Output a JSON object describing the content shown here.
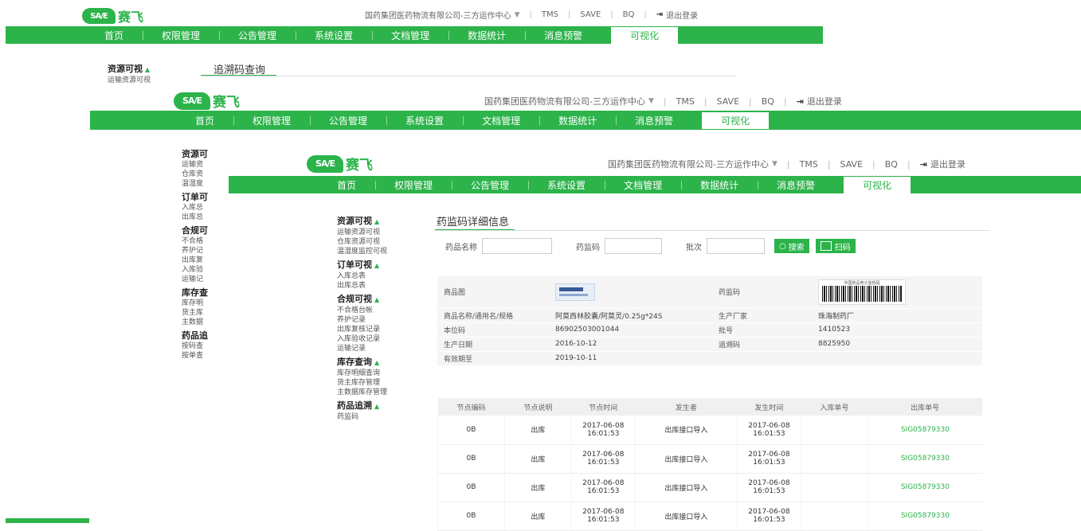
{
  "brand": {
    "badge": "SA/E",
    "name": "赛飞"
  },
  "topbar": {
    "company": "国药集团医药物流有限公司-三方运作中心",
    "links": [
      "TMS",
      "SAVE",
      "BQ"
    ],
    "logout": "退出登录"
  },
  "nav": {
    "items": [
      "首页",
      "权限管理",
      "公告管理",
      "系统设置",
      "文档管理",
      "数据统计",
      "消息预警",
      "可视化"
    ],
    "active": "可视化"
  },
  "sidebar": {
    "groups": [
      {
        "title": "资源可视",
        "items": [
          "运输资源可视",
          "仓库资源可视",
          "温湿度监控可视"
        ]
      },
      {
        "title": "订单可视",
        "items": [
          "入库总表",
          "出库总表"
        ]
      },
      {
        "title": "合规可视",
        "items": [
          "不合格台帐",
          "养护记录",
          "出库复核记录",
          "入库验收记录",
          "运输记录"
        ]
      },
      {
        "title": "库存查询",
        "items": [
          "库存明细查询",
          "货主库存管理",
          "主数据库存管理"
        ]
      },
      {
        "title": "药品追溯",
        "items": [
          "药监码"
        ]
      }
    ],
    "back2_groups": [
      "资源可",
      "订单可",
      "合规可",
      "库存查",
      "药品追"
    ],
    "back2_items": [
      "运输资",
      "仓库资",
      "温湿度",
      "入库总",
      "出库总",
      "不合格",
      "养护记",
      "出库复",
      "入库验",
      "运输记",
      "库存明",
      "货主库",
      "主数据",
      "按码查",
      "按单查"
    ]
  },
  "back_page": {
    "title": "追溯码查询"
  },
  "main": {
    "title": "药监码详细信息",
    "filters": {
      "drug_name_label": "药品名称",
      "code_label": "药监码",
      "batch_label": "批次",
      "search": "搜索",
      "scan": "扫码"
    },
    "detail": {
      "rows": [
        [
          "商品图",
          "",
          "药监码",
          ""
        ],
        [
          "商品名称/通用名/规格",
          "阿莫西林胶囊/阿莫灵/0.25g*24S",
          "生产厂家",
          "珠海制药厂"
        ],
        [
          "本位码",
          "86902503001044",
          "批号",
          "1410523"
        ],
        [
          "生产日期",
          "2016-10-12",
          "追溯码",
          "8825950"
        ],
        [
          "有效期至",
          "2019-10-11",
          "",
          ""
        ]
      ],
      "barcode_caption": "中国药品电子监管码"
    },
    "nodes": {
      "headers": [
        "节点编码",
        "节点说明",
        "节点时间",
        "发生者",
        "发生时间",
        "入库单号",
        "出库单号"
      ],
      "rows": [
        [
          "0B",
          "出库",
          "2017-06-08 16:01:53",
          "出库接口导入",
          "2017-06-08 16:01:53",
          "",
          "SIG05879330"
        ],
        [
          "0B",
          "出库",
          "2017-06-08 16:01:53",
          "出库接口导入",
          "2017-06-08 16:01:53",
          "",
          "SIG05879330"
        ],
        [
          "0B",
          "出库",
          "2017-06-08 16:01:53",
          "出库接口导入",
          "2017-06-08 16:01:53",
          "",
          "SIG05879330"
        ],
        [
          "0B",
          "出库",
          "2017-06-08 16:01:53",
          "出库接口导入",
          "2017-06-08 16:01:53",
          "",
          "SIG05879330"
        ]
      ]
    }
  },
  "colors": {
    "brand_green": "#2cb34a"
  }
}
